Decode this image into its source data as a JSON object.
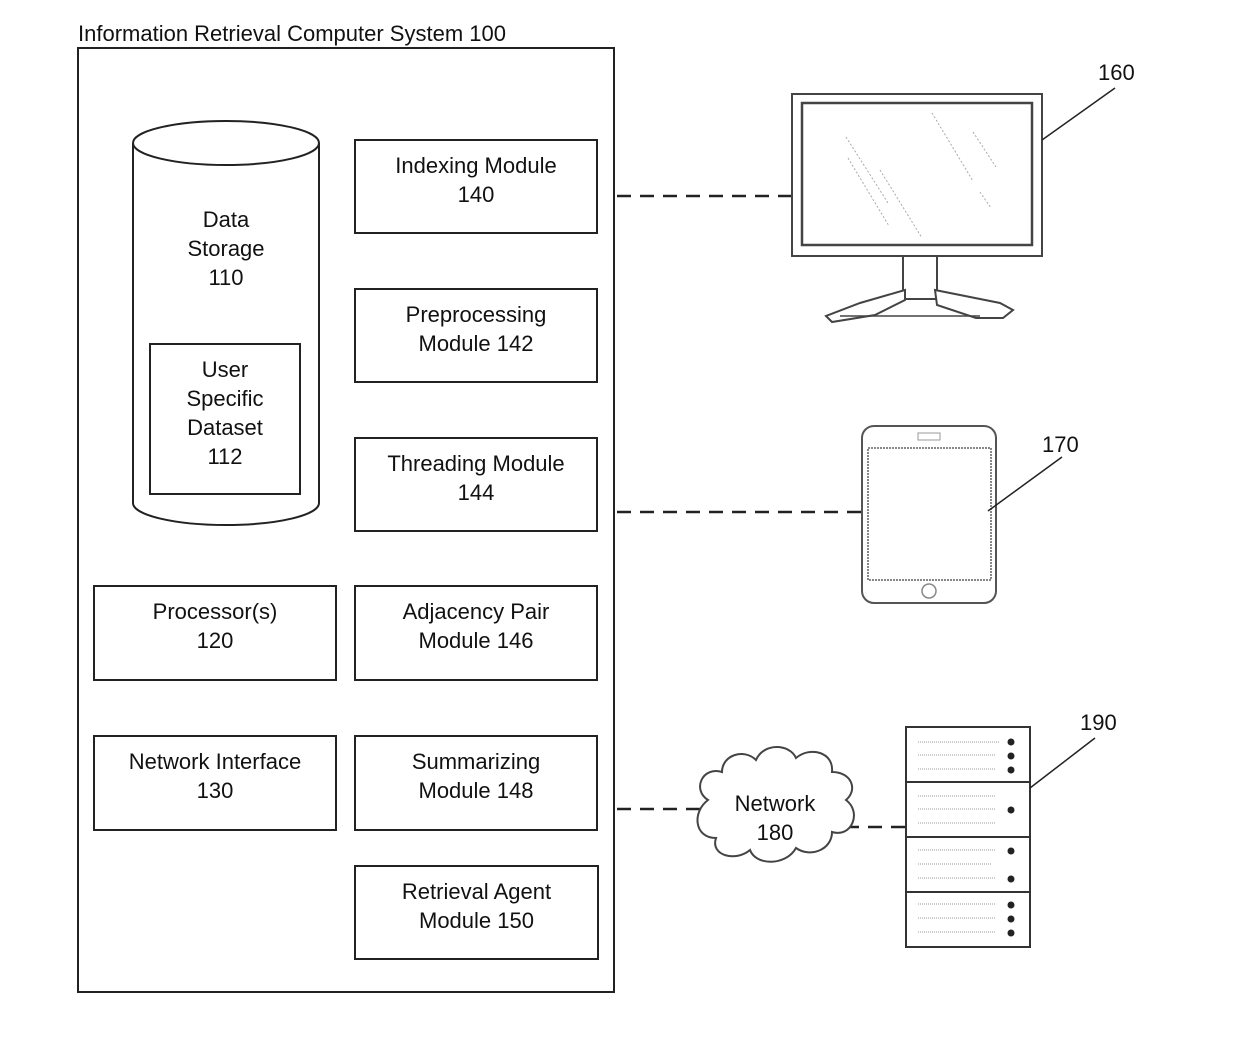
{
  "system": {
    "title": "Information Retrieval Computer System 100"
  },
  "data_storage": {
    "lines": [
      "Data",
      "Storage",
      "110"
    ],
    "dataset": {
      "lines": [
        "User",
        "Specific",
        "Dataset",
        "112"
      ]
    }
  },
  "components": [
    {
      "id": "indexing",
      "lines": [
        "Indexing Module",
        "140"
      ]
    },
    {
      "id": "preprocessing",
      "lines": [
        "Preprocessing",
        "Module 142"
      ]
    },
    {
      "id": "threading",
      "lines": [
        "Threading Module",
        "144"
      ]
    },
    {
      "id": "processor",
      "lines": [
        "Processor(s)",
        "120"
      ]
    },
    {
      "id": "adjacency",
      "lines": [
        "Adjacency Pair",
        "Module 146"
      ]
    },
    {
      "id": "network_interface",
      "lines": [
        "Network Interface",
        "130"
      ]
    },
    {
      "id": "summarizing",
      "lines": [
        "Summarizing",
        "Module 148"
      ]
    },
    {
      "id": "retrieval_agent",
      "lines": [
        "Retrieval Agent",
        "Module 150"
      ]
    }
  ],
  "devices": {
    "monitor": {
      "ref": "160",
      "icon": "desktop-monitor-icon"
    },
    "tablet": {
      "ref": "170",
      "icon": "tablet-icon"
    },
    "network": {
      "lines": [
        "Network",
        "180"
      ],
      "icon": "cloud-icon"
    },
    "server": {
      "ref": "190",
      "icon": "server-rack-icon"
    }
  }
}
